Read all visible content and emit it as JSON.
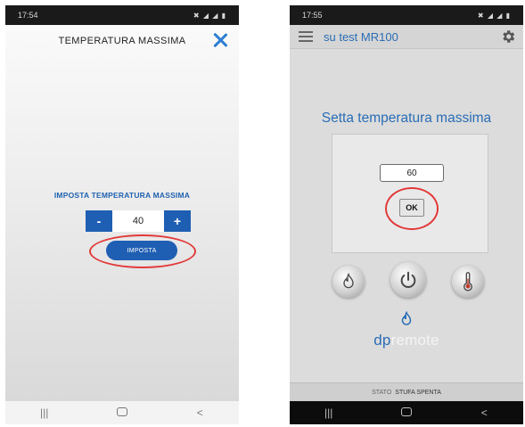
{
  "left_phone": {
    "status_time": "17:54",
    "status_icons": "✖ ◢ ◢ ▮",
    "title": "TEMPERATURA MASSIMA",
    "set_label": "IMPOSTA TEMPERATURA MASSIMA",
    "minus_label": "-",
    "value": "40",
    "plus_label": "+",
    "submit_label": "IMPOSTA",
    "nav": {
      "recent": "|||",
      "back": "<"
    }
  },
  "right_phone": {
    "status_time": "17:55",
    "status_icons": "✖ ◢ ◢ ▮",
    "app_title": "su test MR100",
    "heading": "Setta temperatura massima",
    "input_value": "60",
    "ok_label": "OK",
    "logo_prefix": "dp",
    "logo_suffix": "remote",
    "state_label": "STATO",
    "state_value": "STUFA SPENTA",
    "nav": {
      "recent": "|||",
      "back": "<"
    }
  },
  "colors": {
    "accent": "#2163b0",
    "highlight": "#e23a3a"
  },
  "icons": [
    "close-icon",
    "menu-icon",
    "gear-icon",
    "flame-icon",
    "power-icon",
    "thermometer-icon",
    "dpremote-logo-icon"
  ]
}
